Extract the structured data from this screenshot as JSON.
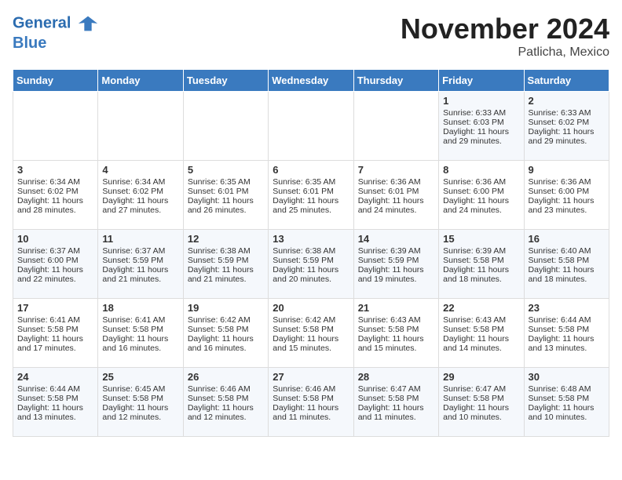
{
  "header": {
    "logo_line1": "General",
    "logo_line2": "Blue",
    "month_title": "November 2024",
    "location": "Patlicha, Mexico"
  },
  "weekdays": [
    "Sunday",
    "Monday",
    "Tuesday",
    "Wednesday",
    "Thursday",
    "Friday",
    "Saturday"
  ],
  "weeks": [
    [
      {
        "day": "",
        "data": ""
      },
      {
        "day": "",
        "data": ""
      },
      {
        "day": "",
        "data": ""
      },
      {
        "day": "",
        "data": ""
      },
      {
        "day": "",
        "data": ""
      },
      {
        "day": "1",
        "data": "Sunrise: 6:33 AM\nSunset: 6:03 PM\nDaylight: 11 hours and 29 minutes."
      },
      {
        "day": "2",
        "data": "Sunrise: 6:33 AM\nSunset: 6:02 PM\nDaylight: 11 hours and 29 minutes."
      }
    ],
    [
      {
        "day": "3",
        "data": "Sunrise: 6:34 AM\nSunset: 6:02 PM\nDaylight: 11 hours and 28 minutes."
      },
      {
        "day": "4",
        "data": "Sunrise: 6:34 AM\nSunset: 6:02 PM\nDaylight: 11 hours and 27 minutes."
      },
      {
        "day": "5",
        "data": "Sunrise: 6:35 AM\nSunset: 6:01 PM\nDaylight: 11 hours and 26 minutes."
      },
      {
        "day": "6",
        "data": "Sunrise: 6:35 AM\nSunset: 6:01 PM\nDaylight: 11 hours and 25 minutes."
      },
      {
        "day": "7",
        "data": "Sunrise: 6:36 AM\nSunset: 6:01 PM\nDaylight: 11 hours and 24 minutes."
      },
      {
        "day": "8",
        "data": "Sunrise: 6:36 AM\nSunset: 6:00 PM\nDaylight: 11 hours and 24 minutes."
      },
      {
        "day": "9",
        "data": "Sunrise: 6:36 AM\nSunset: 6:00 PM\nDaylight: 11 hours and 23 minutes."
      }
    ],
    [
      {
        "day": "10",
        "data": "Sunrise: 6:37 AM\nSunset: 6:00 PM\nDaylight: 11 hours and 22 minutes."
      },
      {
        "day": "11",
        "data": "Sunrise: 6:37 AM\nSunset: 5:59 PM\nDaylight: 11 hours and 21 minutes."
      },
      {
        "day": "12",
        "data": "Sunrise: 6:38 AM\nSunset: 5:59 PM\nDaylight: 11 hours and 21 minutes."
      },
      {
        "day": "13",
        "data": "Sunrise: 6:38 AM\nSunset: 5:59 PM\nDaylight: 11 hours and 20 minutes."
      },
      {
        "day": "14",
        "data": "Sunrise: 6:39 AM\nSunset: 5:59 PM\nDaylight: 11 hours and 19 minutes."
      },
      {
        "day": "15",
        "data": "Sunrise: 6:39 AM\nSunset: 5:58 PM\nDaylight: 11 hours and 18 minutes."
      },
      {
        "day": "16",
        "data": "Sunrise: 6:40 AM\nSunset: 5:58 PM\nDaylight: 11 hours and 18 minutes."
      }
    ],
    [
      {
        "day": "17",
        "data": "Sunrise: 6:41 AM\nSunset: 5:58 PM\nDaylight: 11 hours and 17 minutes."
      },
      {
        "day": "18",
        "data": "Sunrise: 6:41 AM\nSunset: 5:58 PM\nDaylight: 11 hours and 16 minutes."
      },
      {
        "day": "19",
        "data": "Sunrise: 6:42 AM\nSunset: 5:58 PM\nDaylight: 11 hours and 16 minutes."
      },
      {
        "day": "20",
        "data": "Sunrise: 6:42 AM\nSunset: 5:58 PM\nDaylight: 11 hours and 15 minutes."
      },
      {
        "day": "21",
        "data": "Sunrise: 6:43 AM\nSunset: 5:58 PM\nDaylight: 11 hours and 15 minutes."
      },
      {
        "day": "22",
        "data": "Sunrise: 6:43 AM\nSunset: 5:58 PM\nDaylight: 11 hours and 14 minutes."
      },
      {
        "day": "23",
        "data": "Sunrise: 6:44 AM\nSunset: 5:58 PM\nDaylight: 11 hours and 13 minutes."
      }
    ],
    [
      {
        "day": "24",
        "data": "Sunrise: 6:44 AM\nSunset: 5:58 PM\nDaylight: 11 hours and 13 minutes."
      },
      {
        "day": "25",
        "data": "Sunrise: 6:45 AM\nSunset: 5:58 PM\nDaylight: 11 hours and 12 minutes."
      },
      {
        "day": "26",
        "data": "Sunrise: 6:46 AM\nSunset: 5:58 PM\nDaylight: 11 hours and 12 minutes."
      },
      {
        "day": "27",
        "data": "Sunrise: 6:46 AM\nSunset: 5:58 PM\nDaylight: 11 hours and 11 minutes."
      },
      {
        "day": "28",
        "data": "Sunrise: 6:47 AM\nSunset: 5:58 PM\nDaylight: 11 hours and 11 minutes."
      },
      {
        "day": "29",
        "data": "Sunrise: 6:47 AM\nSunset: 5:58 PM\nDaylight: 11 hours and 10 minutes."
      },
      {
        "day": "30",
        "data": "Sunrise: 6:48 AM\nSunset: 5:58 PM\nDaylight: 11 hours and 10 minutes."
      }
    ]
  ]
}
